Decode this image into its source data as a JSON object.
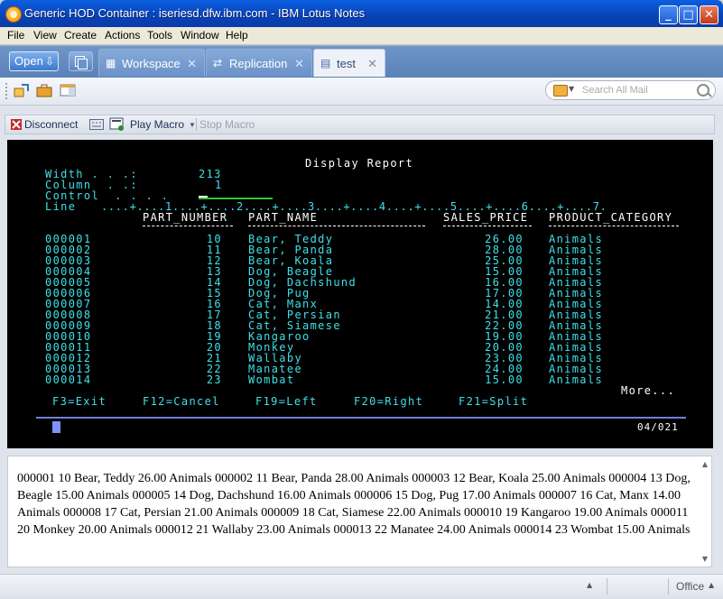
{
  "window": {
    "title": "Generic HOD Container : iseriesd.dfw.ibm.com - IBM Lotus Notes",
    "min_glyph": "_",
    "max_glyph": "□",
    "close_glyph": "✕"
  },
  "menu": [
    "File",
    "View",
    "Create",
    "Actions",
    "Tools",
    "Window",
    "Help"
  ],
  "tabbar": {
    "open_label": "Open",
    "tabs": [
      {
        "label": "Workspace",
        "icon": "workspace-icon",
        "active": false
      },
      {
        "label": "Replication",
        "icon": "replication-icon",
        "active": false
      },
      {
        "label": "test",
        "icon": "form-icon",
        "active": true
      }
    ],
    "close_glyph": "✕"
  },
  "search": {
    "placeholder": "Search All Mail"
  },
  "hod_toolbar": {
    "disconnect": "Disconnect",
    "play_macro": "Play Macro",
    "stop_macro": "Stop Macro"
  },
  "terminal": {
    "title": "Display Report",
    "width_label": "Width . . .:",
    "width_value": "213",
    "column_label": "Column  . .:",
    "column_value": "1",
    "control_label": "Control  . . . .",
    "line_label": "Line",
    "ruler": "....+....1....+....2....+....3....+....4....+....5....+....6....+....7.",
    "headers": [
      "PART_NUMBER",
      "PART_NAME",
      "SALES_PRICE",
      "PRODUCT_CATEGORY"
    ],
    "rows": [
      {
        "line": "000001",
        "num": "10",
        "name": "Bear, Teddy",
        "price": "26.00",
        "cat": "Animals"
      },
      {
        "line": "000002",
        "num": "11",
        "name": "Bear, Panda",
        "price": "28.00",
        "cat": "Animals"
      },
      {
        "line": "000003",
        "num": "12",
        "name": "Bear, Koala",
        "price": "25.00",
        "cat": "Animals"
      },
      {
        "line": "000004",
        "num": "13",
        "name": "Dog, Beagle",
        "price": "15.00",
        "cat": "Animals"
      },
      {
        "line": "000005",
        "num": "14",
        "name": "Dog, Dachshund",
        "price": "16.00",
        "cat": "Animals"
      },
      {
        "line": "000006",
        "num": "15",
        "name": "Dog, Pug",
        "price": "17.00",
        "cat": "Animals"
      },
      {
        "line": "000007",
        "num": "16",
        "name": "Cat, Manx",
        "price": "14.00",
        "cat": "Animals"
      },
      {
        "line": "000008",
        "num": "17",
        "name": "Cat, Persian",
        "price": "21.00",
        "cat": "Animals"
      },
      {
        "line": "000009",
        "num": "18",
        "name": "Cat, Siamese",
        "price": "22.00",
        "cat": "Animals"
      },
      {
        "line": "000010",
        "num": "19",
        "name": "Kangaroo",
        "price": "19.00",
        "cat": "Animals"
      },
      {
        "line": "000011",
        "num": "20",
        "name": "Monkey",
        "price": "20.00",
        "cat": "Animals"
      },
      {
        "line": "000012",
        "num": "21",
        "name": "Wallaby",
        "price": "23.00",
        "cat": "Animals"
      },
      {
        "line": "000013",
        "num": "22",
        "name": "Manatee",
        "price": "24.00",
        "cat": "Animals"
      },
      {
        "line": "000014",
        "num": "23",
        "name": "Wombat",
        "price": "15.00",
        "cat": "Animals"
      }
    ],
    "more": "More...",
    "fkeys": [
      "F3=Exit",
      "F12=Cancel",
      "F19=Left",
      "F20=Right",
      "F21=Split"
    ],
    "position": "04/021"
  },
  "text_output": "000001 10 Bear, Teddy 26.00 Animals 000002 11 Bear, Panda 28.00 Animals 000003 12 Bear, Koala 25.00 Animals 000004 13 Dog, Beagle 15.00 Animals 000005 14 Dog, Dachshund 16.00 Animals 000006 15 Dog, Pug 17.00 Animals 000007 16 Cat, Manx 14.00 Animals 000008 17 Cat, Persian 21.00 Animals 000009 18 Cat, Siamese 22.00 Animals 000010 19 Kangaroo 19.00 Animals 000011 20 Monkey 20.00 Animals 000012 21 Wallaby 23.00 Animals 000013 22 Manatee 24.00 Animals 000014 23 Wombat 15.00 Animals",
  "statusbar": {
    "location": "Office"
  }
}
